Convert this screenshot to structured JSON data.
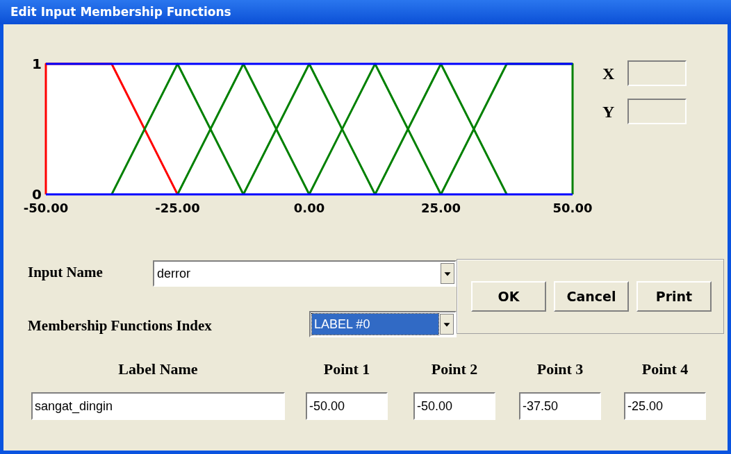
{
  "window": {
    "title": "Edit Input Membership Functions"
  },
  "chart_data": {
    "type": "line",
    "x": [
      -50,
      -50,
      -37.5,
      -25,
      -12.5,
      0,
      12.5,
      25,
      37.5,
      50,
      50
    ],
    "xlim": [
      -50,
      50
    ],
    "ylim": [
      0,
      1
    ],
    "xticks": [
      {
        "value": -50,
        "label": "-50.00"
      },
      {
        "value": -25,
        "label": "-25.00"
      },
      {
        "value": 0,
        "label": "0.00"
      },
      {
        "value": 25,
        "label": "25.00"
      },
      {
        "value": 50,
        "label": "50.00"
      }
    ],
    "yticks": [
      0,
      1
    ],
    "series": [
      {
        "color": "#ff0000",
        "values": [
          0,
          1,
          1,
          0,
          null,
          null,
          null,
          null,
          null,
          null,
          null
        ]
      },
      {
        "color": "#008000",
        "values": [
          null,
          null,
          0,
          1,
          0,
          null,
          null,
          null,
          null,
          null,
          null
        ]
      },
      {
        "color": "#008000",
        "values": [
          null,
          null,
          null,
          0,
          1,
          0,
          null,
          null,
          null,
          null,
          null
        ]
      },
      {
        "color": "#008000",
        "values": [
          null,
          null,
          null,
          null,
          0,
          1,
          0,
          null,
          null,
          null,
          null
        ]
      },
      {
        "color": "#008000",
        "values": [
          null,
          null,
          null,
          null,
          null,
          0,
          1,
          0,
          null,
          null,
          null
        ]
      },
      {
        "color": "#008000",
        "values": [
          null,
          null,
          null,
          null,
          null,
          null,
          0,
          1,
          0,
          null,
          null
        ]
      },
      {
        "color": "#008000",
        "values": [
          null,
          null,
          null,
          null,
          null,
          null,
          null,
          0,
          1,
          1,
          0
        ]
      }
    ]
  },
  "coords": [
    {
      "label": "X"
    },
    {
      "label": "Y"
    }
  ],
  "input_name": {
    "label": "Input Name",
    "value": "derror"
  },
  "mf_index": {
    "label": "Membership Functions Index",
    "value": "LABEL #0"
  },
  "buttons": [
    "OK",
    "Cancel",
    "Print"
  ],
  "columns": [
    "Label Name",
    "Point 1",
    "Point 2",
    "Point 3",
    "Point 4"
  ],
  "values": [
    "sangat_dingin",
    "-50.00",
    "-50.00",
    "-37.50",
    "-25.00"
  ]
}
